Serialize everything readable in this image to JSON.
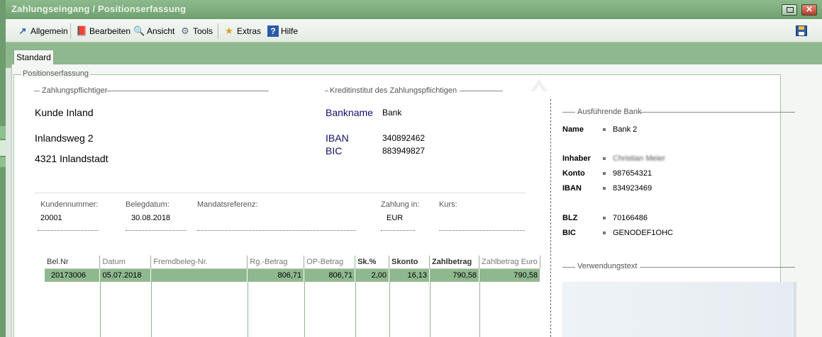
{
  "window": {
    "title": "Zahlungseingang / Positionserfassung"
  },
  "toolbar": {
    "items": [
      {
        "label": "Allgemein",
        "icon": "arrow-icon"
      },
      {
        "label": "Bearbeiten",
        "icon": "edit-icon"
      },
      {
        "label": "Ansicht",
        "icon": "view-icon"
      },
      {
        "label": "Tools",
        "icon": "gear-icon"
      },
      {
        "label": "Extras",
        "icon": "extras-icon"
      },
      {
        "label": "Hilfe",
        "icon": "help-icon"
      }
    ]
  },
  "tabs": [
    {
      "label": "Standard"
    }
  ],
  "group": {
    "label": "Positionserfassung"
  },
  "payer": {
    "section_label": "Zahlungspflichtiger",
    "name": "Kunde Inland",
    "street": "Inlandsweg 2",
    "city": "4321 Inlandstadt"
  },
  "payer_bank": {
    "section_label": "Kreditinstitut des Zahlungspflichtigen",
    "bankname_label": "Bankname",
    "bankname_value": "Bank",
    "iban_label": "IBAN",
    "iban_value": "340892462",
    "bic_label": "BIC",
    "bic_value": "883949827"
  },
  "fields": {
    "kundennummer": {
      "label": "Kundennummer:",
      "value": "20001"
    },
    "belegdatum": {
      "label": "Belegdatum:",
      "value": "30.08.2018"
    },
    "mandatsreferenz": {
      "label": "Mandatsreferenz:",
      "value": ""
    },
    "zahlung_in": {
      "label": "Zahlung in:",
      "value": "EUR"
    },
    "kurs": {
      "label": "Kurs:",
      "value": ""
    }
  },
  "table": {
    "columns": [
      "Bel.Nr",
      "Datum",
      "Fremdbeleg-Nr.",
      "Rg.-Betrag",
      "OP-Betrag",
      "Sk.%",
      "Skonto",
      "Zahlbetrag",
      "Zahlbetrag Euro"
    ],
    "rows": [
      [
        "20173006",
        "05.07.2018",
        "",
        "806,71",
        "806,71",
        "2,00",
        "16,13",
        "790,58",
        "790,58"
      ]
    ]
  },
  "exec_bank": {
    "section_label": "Ausführende Bank",
    "name_label": "Name",
    "name_value": "Bank 2",
    "inhaber_label": "Inhaber",
    "inhaber_value": "Christian Meier",
    "konto_label": "Konto",
    "konto_value": "987654321",
    "iban_label": "IBAN",
    "iban_value": "834923469",
    "blz_label": "BLZ",
    "blz_value": "70166486",
    "bic_label": "BIC",
    "bic_value": "GENODEF1OHC"
  },
  "verwendungstext": {
    "label": "Verwendungstext"
  }
}
